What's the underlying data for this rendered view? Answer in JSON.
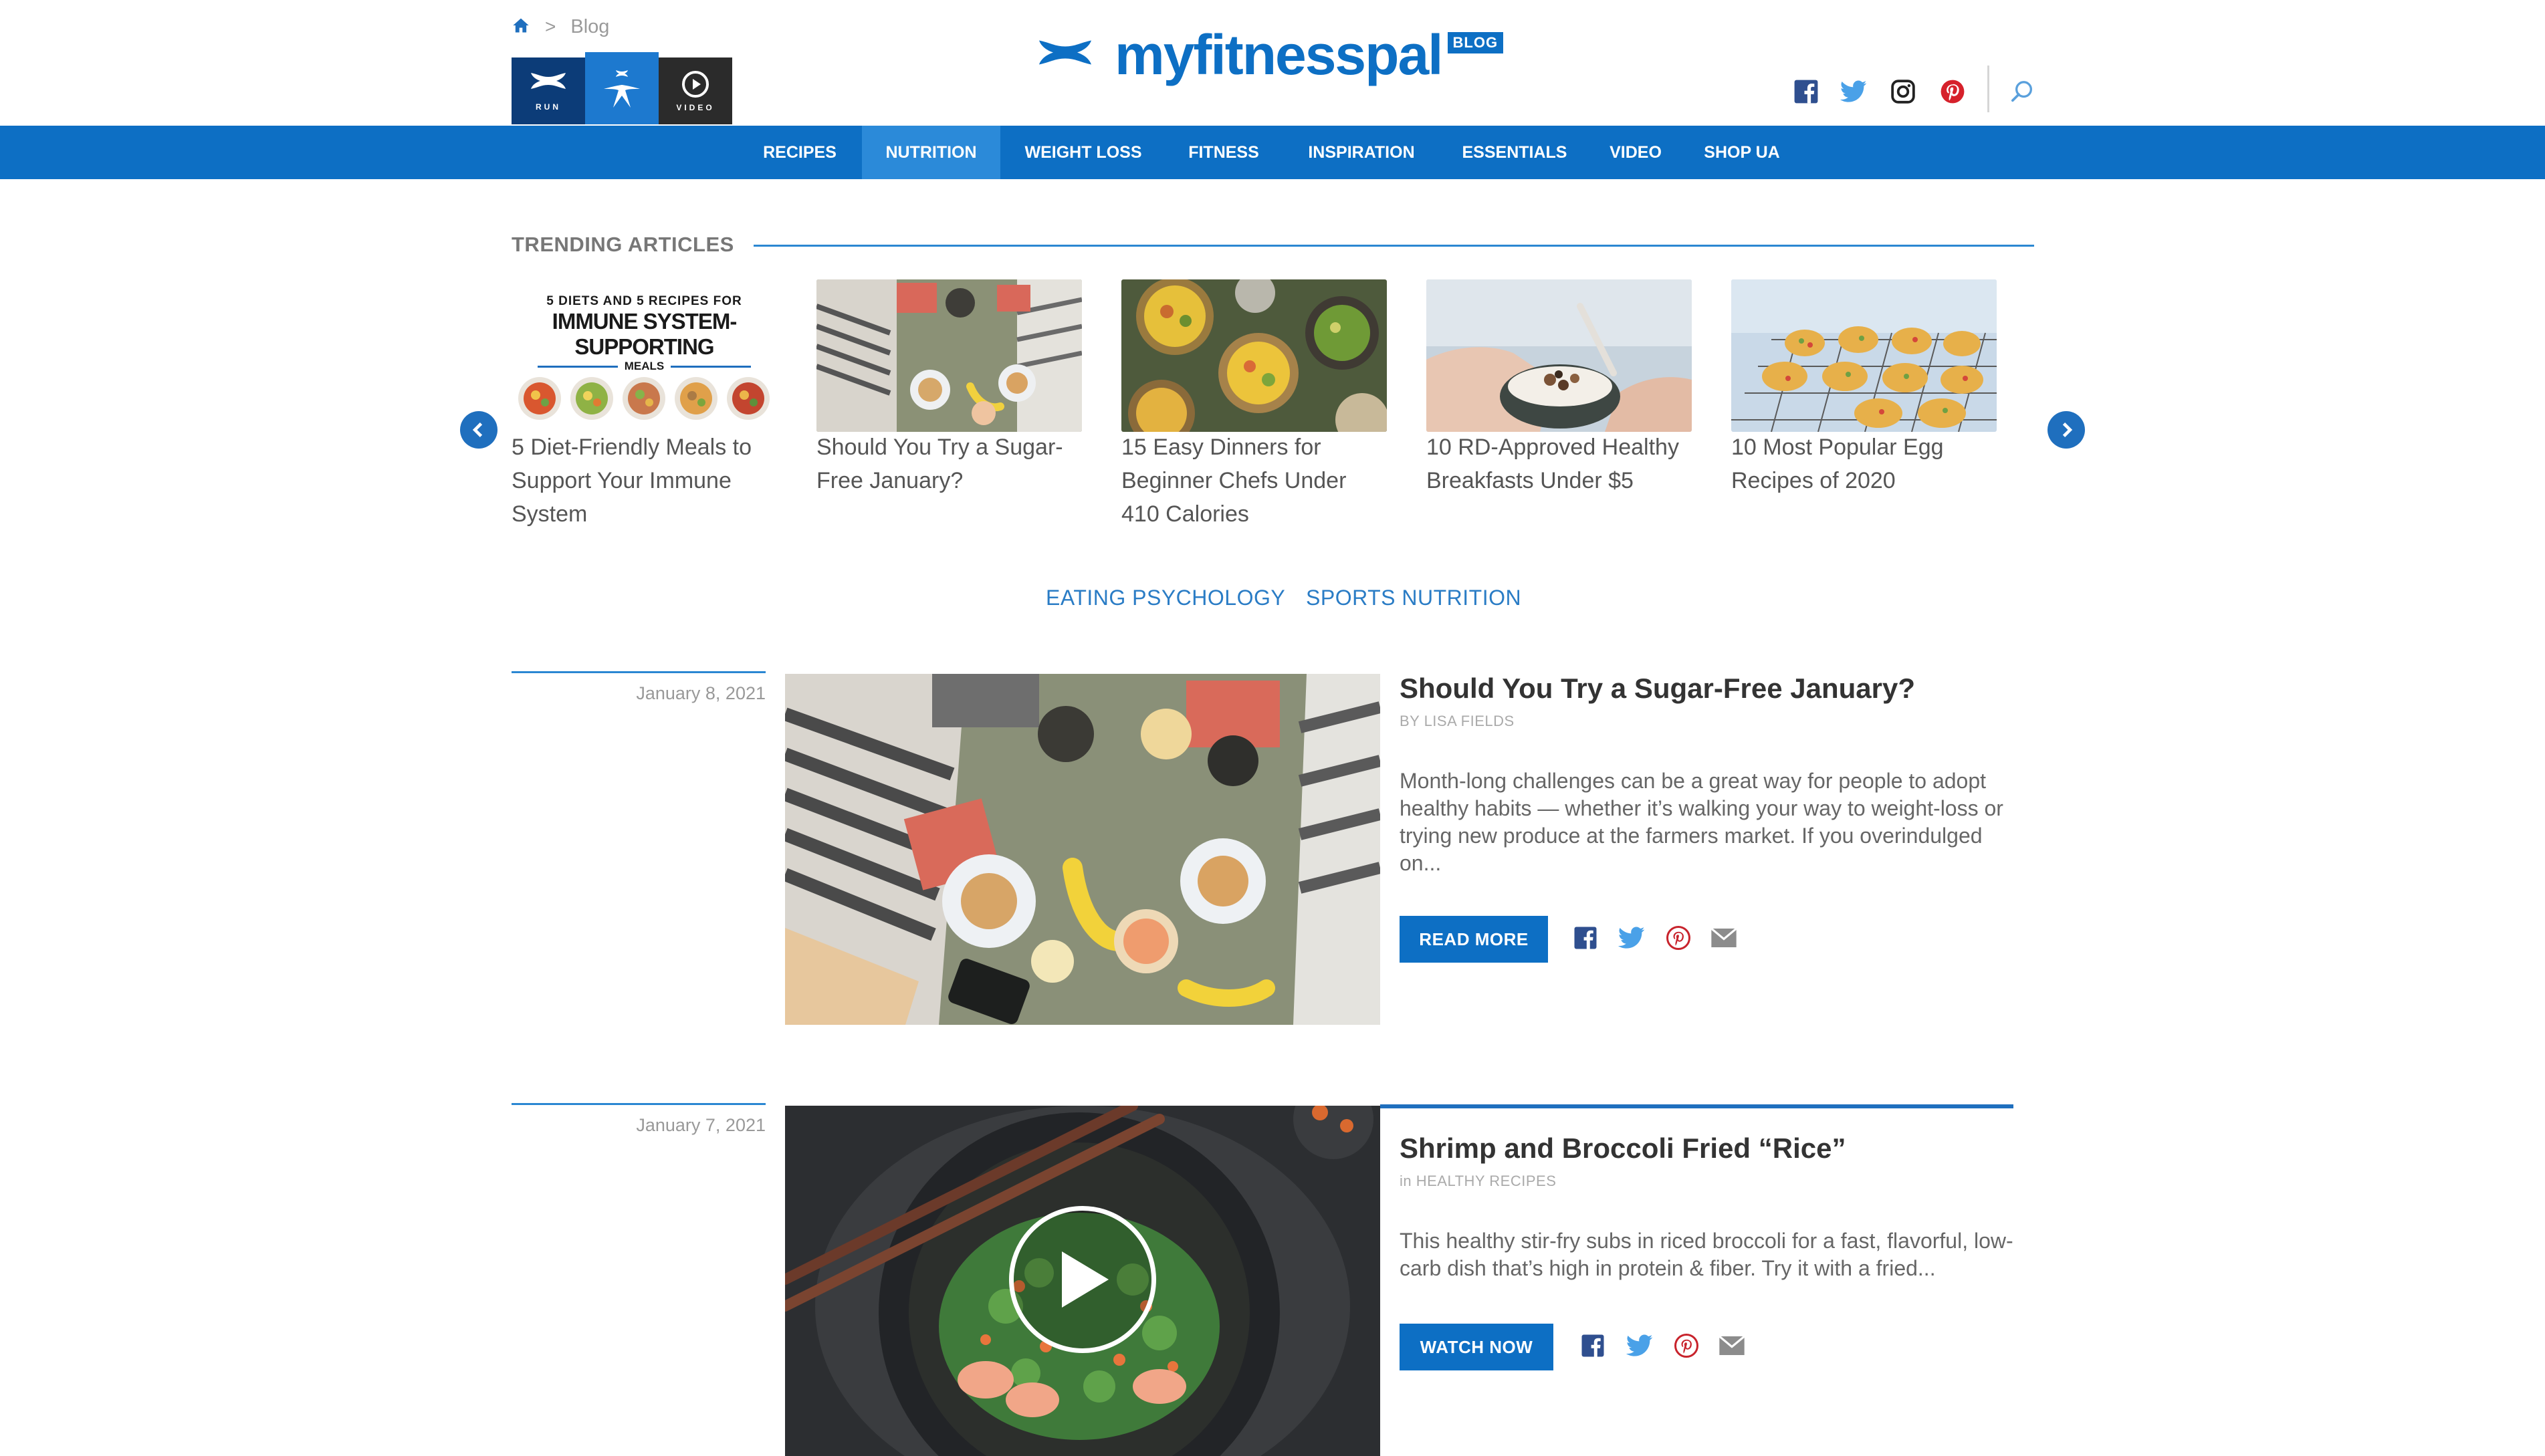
{
  "breadcrumb": {
    "blog": "Blog",
    "separator": ">"
  },
  "apps": [
    {
      "label": "RUN",
      "bg": "#0c3c78"
    },
    {
      "label": "",
      "bg": "#1d79cf"
    },
    {
      "label": "VIDEO",
      "bg": "#2b2b2b"
    }
  ],
  "logo": {
    "text": "myfitnesspal",
    "badge": "BLOG"
  },
  "nav": {
    "items": [
      "RECIPES",
      "NUTRITION",
      "WEIGHT LOSS",
      "FITNESS",
      "INSPIRATION",
      "ESSENTIALS",
      "VIDEO",
      "SHOP UA"
    ],
    "active_index": 1
  },
  "trending": {
    "title": "TRENDING ARTICLES",
    "cards": [
      {
        "title": "5 Diet-Friendly Meals to Support Your Immune System",
        "thumb_line1": "5 DIETS AND 5 RECIPES FOR",
        "thumb_line2": "IMMUNE SYSTEM-SUPPORTING",
        "thumb_line3": "MEALS"
      },
      {
        "title": "Should You Try a Sugar-Free January?"
      },
      {
        "title": "15 Easy Dinners for Beginner Chefs Under 410 Calories"
      },
      {
        "title": "10 RD-Approved Healthy Breakfasts Under $5"
      },
      {
        "title": "10 Most Popular Egg Recipes of 2020"
      }
    ]
  },
  "subcategories": [
    "EATING PSYCHOLOGY",
    "SPORTS NUTRITION"
  ],
  "articles": [
    {
      "date": "January 8, 2021",
      "title": "Should You Try a Sugar-Free January?",
      "byline": "BY LISA FIELDS",
      "excerpt": "Month-long challenges can be a great way for people to adopt healthy habits — whether it’s walking your way to weight-loss or trying new produce at the farmers market. If you overindulged on...",
      "button": "READ MORE"
    },
    {
      "date": "January 7, 2021",
      "title": "Shrimp and Broccoli Fried “Rice”",
      "byline": "in HEALTHY RECIPES",
      "excerpt": "This healthy stir-fry subs in riced broccoli for a fast, flavorful, low-carb dish that’s high in protein & fiber. Try it with a fried...",
      "button": "WATCH NOW"
    }
  ],
  "colors": {
    "brand": "#0d6fc4",
    "nav_active": "#2b8ad9",
    "link": "#2a7cc5"
  }
}
